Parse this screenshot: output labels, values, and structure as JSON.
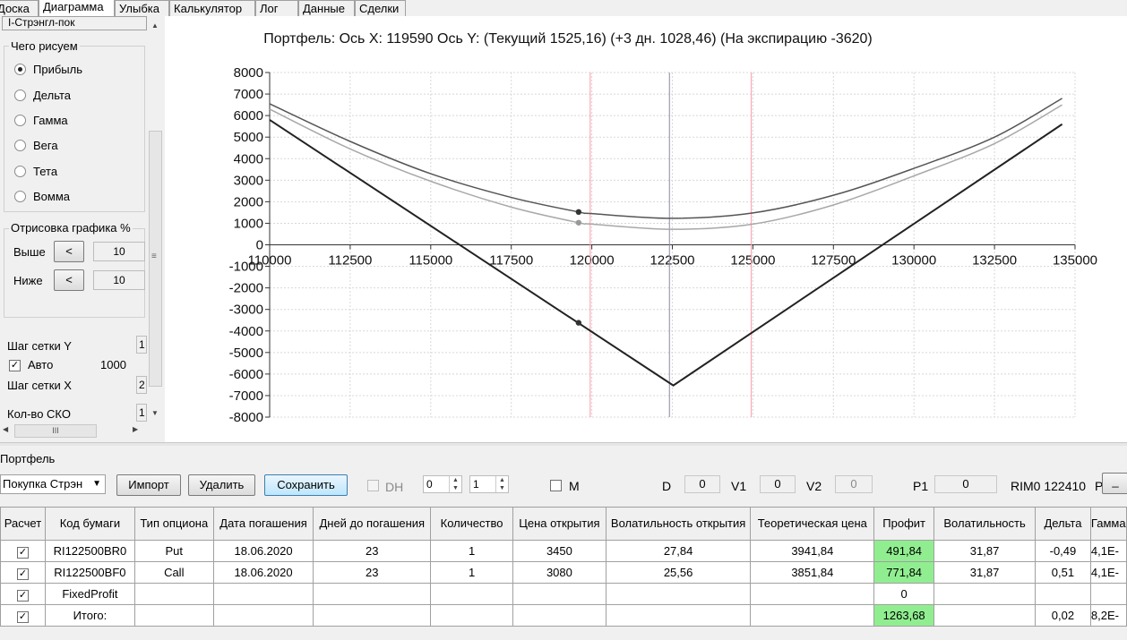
{
  "tabs": [
    "Доска",
    "Диаграмма",
    "Улыбка",
    "Калькулятор",
    "Лог",
    "Данные",
    "Сделки"
  ],
  "left": {
    "strategy": "I-Стрэнгл-пок",
    "draw_group_title": "Чего рисуем",
    "radios": [
      {
        "label": "Прибыль",
        "checked": true
      },
      {
        "label": "Дельта",
        "checked": false
      },
      {
        "label": "Гамма",
        "checked": false
      },
      {
        "label": "Вега",
        "checked": false
      },
      {
        "label": "Тета",
        "checked": false
      },
      {
        "label": "Вомма",
        "checked": false
      }
    ],
    "range_group_title": "Отрисовка графика %",
    "above_label": "Выше",
    "above_btn": "<",
    "above_value": "10",
    "below_label": "Ниже",
    "below_btn": "<",
    "below_value": "10",
    "grid_y_label": "Шаг сетки Y",
    "grid_y_value": "1",
    "auto_label": "Авто",
    "auto_checked": true,
    "auto_value": "1000",
    "grid_x_label": "Шаг сетки X",
    "grid_x_value": "2",
    "sko_label": "Кол-во СКО",
    "sko_value": "1"
  },
  "chart_data": {
    "type": "line",
    "title": "Портфель: Ось X: 119590 Ось Y:  (Текущий 1525,16)  (+3 дн. 1028,46)  (На экспирацию -3620)",
    "xlim": [
      110000,
      135000
    ],
    "ylim": [
      -8000,
      8000
    ],
    "x_ticks": [
      110000,
      112500,
      115000,
      117500,
      120000,
      122500,
      125000,
      127500,
      130000,
      132500,
      135000
    ],
    "y_ticks": [
      8000,
      7000,
      6000,
      5000,
      4000,
      3000,
      2000,
      1000,
      0,
      -1000,
      -2000,
      -3000,
      -4000,
      -5000,
      -6000,
      -7000,
      -8000
    ],
    "grid": true,
    "series": [
      {
        "color": "#555555",
        "x": [
          110000,
          112500,
          115000,
          117500,
          119590,
          120000,
          122500,
          125000,
          127500,
          130000,
          132500,
          134600
        ],
        "y": [
          6550,
          4800,
          3300,
          2200,
          1525,
          1450,
          1230,
          1480,
          2300,
          3550,
          5000,
          6800
        ]
      },
      {
        "color": "#a8a8a8",
        "x": [
          110000,
          112500,
          115000,
          117500,
          119590,
          120000,
          122500,
          125000,
          127500,
          130000,
          132500,
          134600
        ],
        "y": [
          6300,
          4450,
          2950,
          1750,
          1028,
          960,
          720,
          960,
          1850,
          3200,
          4700,
          6500
        ]
      },
      {
        "color": "#222222",
        "x": [
          110000,
          122530,
          134600
        ],
        "y": [
          5800,
          -6530,
          5600
        ]
      }
    ],
    "markers": [
      {
        "x": 119590,
        "y": 1525
      },
      {
        "x": 119590,
        "y": 1028
      },
      {
        "x": 119590,
        "y": -3620
      }
    ],
    "vlines": [
      {
        "x": 119950,
        "color": "#ff9aa8"
      },
      {
        "x": 122410,
        "color": "#8a8aa8"
      },
      {
        "x": 124950,
        "color": "#ff9aa8"
      }
    ]
  },
  "bottom": {
    "section_label": "Портфель",
    "select_value": "Покупка Стрэн",
    "import_btn": "Импорт",
    "delete_btn": "Удалить",
    "save_btn": "Сохранить",
    "dh_label": "DH",
    "spin1": "0",
    "spin2": "1",
    "m_label": "M",
    "d_label": "D",
    "d_value": "0",
    "v1_label": "V1",
    "v1_value": "0",
    "v2_label": "V2",
    "v2_value": "0",
    "p1_label": "P1",
    "p1_value": "0",
    "ticker": "RIM0 122410",
    "p_label": "P",
    "p_btn": "_"
  },
  "table": {
    "headers": [
      "Расчет",
      "Код бумаги",
      "Тип опциона",
      "Дата погашения",
      "Дней до погашения",
      "Количество",
      "Цена открытия",
      "Волатильность открытия",
      "Теоретическая цена",
      "Профит",
      "Волатильность",
      "Дельта",
      "Гамма"
    ],
    "rows": [
      {
        "checked": true,
        "cells": [
          "RI122500BR0",
          "Put",
          "18.06.2020",
          "23",
          "1",
          "3450",
          "27,84",
          "3941,84",
          "491,84",
          "31,87",
          "-0,49",
          "4,1E-"
        ]
      },
      {
        "checked": true,
        "cells": [
          "RI122500BF0",
          "Call",
          "18.06.2020",
          "23",
          "1",
          "3080",
          "25,56",
          "3851,84",
          "771,84",
          "31,87",
          "0,51",
          "4,1E-"
        ]
      },
      {
        "checked": true,
        "cells": [
          "FixedProfit",
          "",
          "",
          "",
          "",
          "",
          "",
          "",
          "0",
          "",
          "",
          ""
        ]
      },
      {
        "checked": true,
        "cells": [
          "Итого:",
          "",
          "",
          "",
          "",
          "",
          "",
          "",
          "1263,68",
          "",
          "0,02",
          "8,2E-"
        ]
      }
    ]
  }
}
